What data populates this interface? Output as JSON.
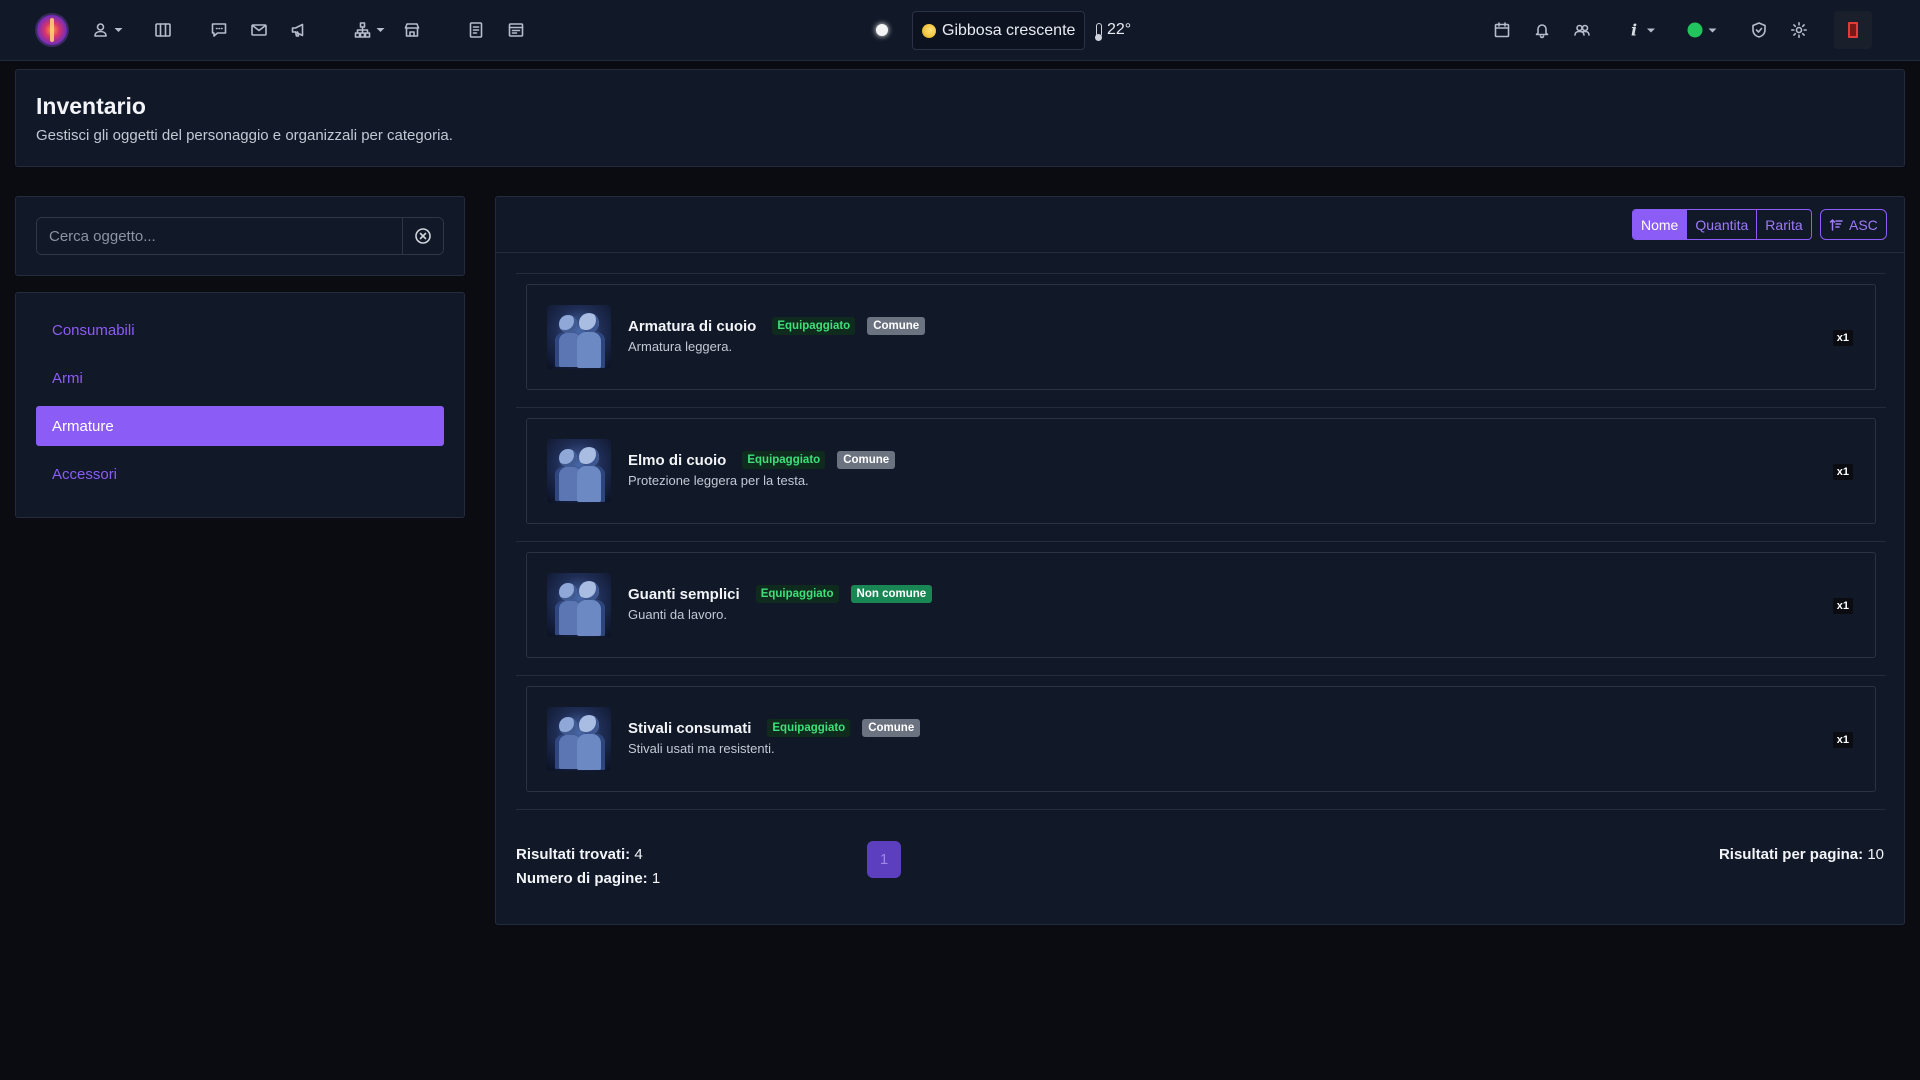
{
  "navbar": {
    "moon_phase": "Gibbosa crescente",
    "temperature": "22°",
    "icons": [
      "logo",
      "user-icon",
      "map-icon",
      "chat-icon",
      "mail-icon",
      "megaphone-icon",
      "hierarchy-icon",
      "shop-icon",
      "journal-icon",
      "calendar-app-icon",
      "sun-icon",
      "calendar-icon",
      "bell-icon",
      "friends-icon",
      "info-icon",
      "status-dot",
      "shield-icon",
      "gear-icon",
      "exit-icon"
    ],
    "status_color": "#21c45d",
    "info_label": "i"
  },
  "header": {
    "title": "Inventario",
    "subtitle": "Gestisci gli oggetti del personaggio e organizzali per categoria."
  },
  "search": {
    "placeholder": "Cerca oggetto...",
    "value": ""
  },
  "categories": [
    {
      "label": "Consumabili",
      "active": false
    },
    {
      "label": "Armi",
      "active": false
    },
    {
      "label": "Armature",
      "active": true
    },
    {
      "label": "Accessori",
      "active": false
    }
  ],
  "sort": {
    "options": [
      "Nome",
      "Quantita",
      "Rarita"
    ],
    "active": "Nome",
    "direction": "ASC"
  },
  "items": [
    {
      "name": "Armatura di cuoio",
      "equipped_label": "Equipaggiato",
      "rarity": "Comune",
      "rarity_color": "#6b7280",
      "description": "Armatura leggera.",
      "qty": "x1"
    },
    {
      "name": "Elmo di cuoio",
      "equipped_label": "Equipaggiato",
      "rarity": "Comune",
      "rarity_color": "#6b7280",
      "description": "Protezione leggera per la testa.",
      "qty": "x1"
    },
    {
      "name": "Guanti semplici",
      "equipped_label": "Equipaggiato",
      "rarity": "Non comune",
      "rarity_color": "#198754",
      "description": "Guanti da lavoro.",
      "qty": "x1"
    },
    {
      "name": "Stivali consumati",
      "equipped_label": "Equipaggiato",
      "rarity": "Comune",
      "rarity_color": "#6b7280",
      "description": "Stivali usati ma resistenti.",
      "qty": "x1"
    }
  ],
  "footer": {
    "results_label": "Risultati trovati:",
    "results_value": "4",
    "pages_label": "Numero di pagine:",
    "pages_value": "1",
    "current_page": "1",
    "per_page_label": "Risultati per pagina:",
    "per_page_value": "10"
  },
  "colors": {
    "accent": "#8b5cf6",
    "equipped": "#3ee07a"
  }
}
